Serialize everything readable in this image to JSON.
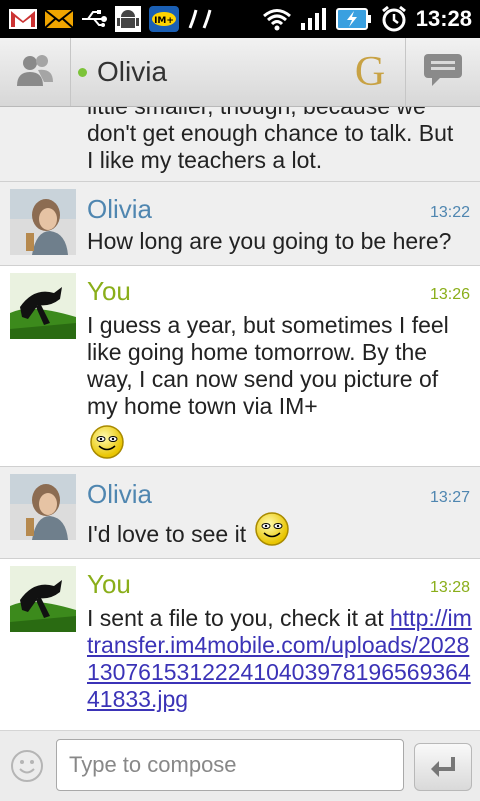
{
  "status_bar": {
    "time": "13:28",
    "icons": [
      "gmail-icon",
      "email-icon",
      "usb-icon",
      "android-debug-icon",
      "im-plus-icon",
      "missed-signal-icon",
      "wifi-icon",
      "signal-icon",
      "battery-charging-icon",
      "alarm-icon"
    ]
  },
  "header": {
    "contact_name": "Olivia",
    "status_color": "#7cc339",
    "service_letter": "G",
    "service_color": "#c8a244"
  },
  "messages": [
    {
      "type": "them-continued",
      "lines": [
        "little smaller, though, because we",
        "don't get enough chance to talk. But",
        "I like my teachers a lot."
      ]
    },
    {
      "type": "them",
      "sender": "Olivia",
      "time": "13:22",
      "text": "How long are you going to be here?"
    },
    {
      "type": "me",
      "sender": "You",
      "time": "13:26",
      "text": "I guess a year, but sometimes I feel like going home tomorrow. By the way, I can now send you picture of my home town via IM+",
      "emoticon": "smiley-icon"
    },
    {
      "type": "them",
      "sender": "Olivia",
      "time": "13:27",
      "text": "I'd love to see it",
      "emoticon": "smiley-icon"
    },
    {
      "type": "me",
      "sender": "You",
      "time": "13:28",
      "text_prefix": "I sent a file to you, check it at ",
      "link": "http://imtransfer.im4mobile.com/uploads/202813076153122241040397819656936441833.jpg"
    }
  ],
  "compose": {
    "placeholder": "Type to compose"
  },
  "colors": {
    "them_name": "#4f86b0",
    "me_name": "#8aae1a",
    "link": "#3b33b7"
  }
}
